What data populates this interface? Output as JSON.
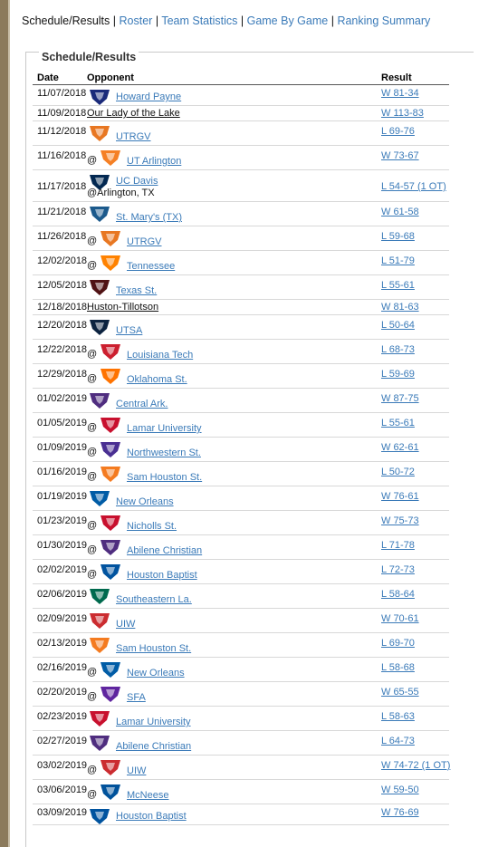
{
  "nav": {
    "current": "Schedule/Results",
    "links": [
      "Roster",
      "Team Statistics",
      "Game By Game",
      "Ranking Summary"
    ],
    "separator": "|"
  },
  "section": {
    "title": "Schedule/Results"
  },
  "columns": {
    "date": "Date",
    "opponent": "Opponent",
    "result": "Result"
  },
  "games": [
    {
      "date": "11/07/2018",
      "at": "",
      "opponent": "Howard Payne",
      "result": "W 81-34",
      "logo": "hpu-logo",
      "color": "#1a2a7a"
    },
    {
      "date": "11/09/2018",
      "at": "",
      "opponent": "Our Lady of the Lake",
      "result": "W 113-83",
      "logo": "",
      "color": ""
    },
    {
      "date": "11/12/2018",
      "at": "",
      "opponent": "UTRGV",
      "result": "L 69-76",
      "logo": "utrgv-logo",
      "color": "#e87722"
    },
    {
      "date": "11/16/2018",
      "at": "@",
      "opponent": "UT Arlington",
      "result": "W 73-67",
      "logo": "uta-logo",
      "color": "#f58025"
    },
    {
      "date": "11/17/2018",
      "at": "",
      "opponent": "UC Davis",
      "location": "@Arlington, TX",
      "result": "L 54-57 (1 OT)",
      "logo": "ucdavis-logo",
      "color": "#022851"
    },
    {
      "date": "11/21/2018",
      "at": "",
      "opponent": "St. Mary's (TX)",
      "result": "W 61-58",
      "logo": "stmarys-logo",
      "color": "#1c5a8c"
    },
    {
      "date": "11/26/2018",
      "at": "@",
      "opponent": "UTRGV",
      "result": "L 59-68",
      "logo": "utrgv-logo",
      "color": "#e87722"
    },
    {
      "date": "12/02/2018",
      "at": "@",
      "opponent": "Tennessee",
      "result": "L 51-79",
      "logo": "tennessee-logo",
      "color": "#ff8200"
    },
    {
      "date": "12/05/2018",
      "at": "",
      "opponent": "Texas St.",
      "result": "L 55-61",
      "logo": "txstate-logo",
      "color": "#501214"
    },
    {
      "date": "12/18/2018",
      "at": "",
      "opponent": "Huston-Tillotson",
      "result": "W 81-63",
      "logo": "",
      "color": ""
    },
    {
      "date": "12/20/2018",
      "at": "",
      "opponent": "UTSA",
      "result": "L 50-64",
      "logo": "utsa-logo",
      "color": "#0c2340"
    },
    {
      "date": "12/22/2018",
      "at": "@",
      "opponent": "Louisiana Tech",
      "result": "L 68-73",
      "logo": "latech-logo",
      "color": "#cc1f2f"
    },
    {
      "date": "12/29/2018",
      "at": "@",
      "opponent": "Oklahoma St.",
      "result": "L 59-69",
      "logo": "okstate-logo",
      "color": "#ff7300"
    },
    {
      "date": "01/02/2019",
      "at": "",
      "opponent": "Central Ark.",
      "result": "W 87-75",
      "logo": "centralark-logo",
      "color": "#4f2d7f"
    },
    {
      "date": "01/05/2019",
      "at": "@",
      "opponent": "Lamar University",
      "result": "L 55-61",
      "logo": "lamar-logo",
      "color": "#c8102e"
    },
    {
      "date": "01/09/2019",
      "at": "@",
      "opponent": "Northwestern St.",
      "result": "W 62-61",
      "logo": "nwstate-logo",
      "color": "#492f92"
    },
    {
      "date": "01/16/2019",
      "at": "@",
      "opponent": "Sam Houston St.",
      "result": "L 50-72",
      "logo": "samhouston-logo",
      "color": "#f47b20"
    },
    {
      "date": "01/19/2019",
      "at": "",
      "opponent": "New Orleans",
      "result": "W 76-61",
      "logo": "neworleans-logo",
      "color": "#005ca6"
    },
    {
      "date": "01/23/2019",
      "at": "@",
      "opponent": "Nicholls St.",
      "result": "W 75-73",
      "logo": "nicholls-logo",
      "color": "#c8102e"
    },
    {
      "date": "01/30/2019",
      "at": "@",
      "opponent": "Abilene Christian",
      "result": "L 71-78",
      "logo": "acu-logo",
      "color": "#4f2d7f"
    },
    {
      "date": "02/02/2019",
      "at": "@",
      "opponent": "Houston Baptist",
      "result": "L 72-73",
      "logo": "hbu-logo",
      "color": "#00539f"
    },
    {
      "date": "02/06/2019",
      "at": "",
      "opponent": "Southeastern La.",
      "result": "L 58-64",
      "logo": "selu-logo",
      "color": "#006a4e"
    },
    {
      "date": "02/09/2019",
      "at": "",
      "opponent": "UIW",
      "result": "W 70-61",
      "logo": "uiw-logo",
      "color": "#cb2c30"
    },
    {
      "date": "02/13/2019",
      "at": "",
      "opponent": "Sam Houston St.",
      "result": "L 69-70",
      "logo": "samhouston-logo",
      "color": "#f47b20"
    },
    {
      "date": "02/16/2019",
      "at": "@",
      "opponent": "New Orleans",
      "result": "L 58-68",
      "logo": "neworleans-logo",
      "color": "#005ca6"
    },
    {
      "date": "02/20/2019",
      "at": "@",
      "opponent": "SFA",
      "result": "W 65-55",
      "logo": "sfa-logo",
      "color": "#5f259f"
    },
    {
      "date": "02/23/2019",
      "at": "",
      "opponent": "Lamar University",
      "result": "L 58-63",
      "logo": "lamar-logo",
      "color": "#c8102e"
    },
    {
      "date": "02/27/2019",
      "at": "",
      "opponent": "Abilene Christian",
      "result": "L 64-73",
      "logo": "acu-logo",
      "color": "#4f2d7f"
    },
    {
      "date": "03/02/2019",
      "at": "@",
      "opponent": "UIW",
      "result": "W 74-72 (1 OT)",
      "logo": "uiw-logo",
      "color": "#cb2c30"
    },
    {
      "date": "03/06/2019",
      "at": "@",
      "opponent": "McNeese",
      "result": "W 59-50",
      "logo": "mcneese-logo",
      "color": "#00529b"
    },
    {
      "date": "03/09/2019",
      "at": "",
      "opponent": "Houston Baptist",
      "result": "W 76-69",
      "logo": "hbu-logo",
      "color": "#00539f"
    }
  ]
}
